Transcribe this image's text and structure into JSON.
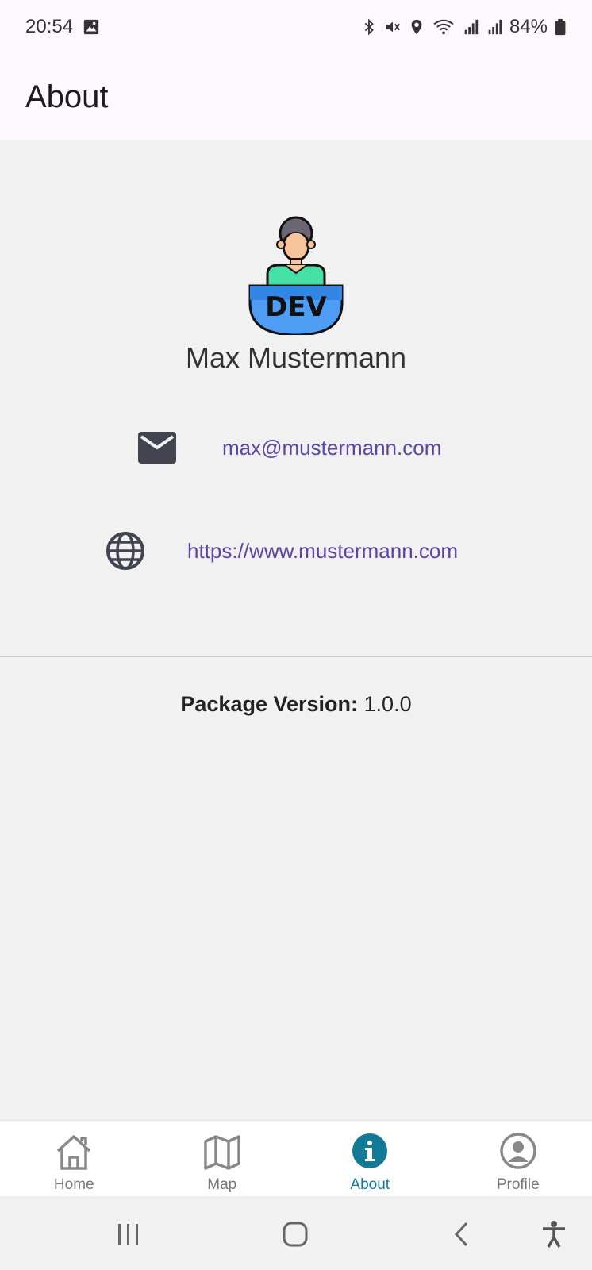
{
  "status_bar": {
    "time": "20:54",
    "battery_percent": "84%",
    "icons": [
      "image-icon",
      "bluetooth-icon",
      "mute-icon",
      "location-icon",
      "wifi-icon",
      "signal-icon",
      "signal-icon",
      "battery-icon"
    ]
  },
  "app_bar": {
    "title": "About"
  },
  "developer": {
    "avatar_badge": "DEV",
    "name": "Max Mustermann",
    "email": "max@mustermann.com",
    "website": "https://www.mustermann.com"
  },
  "version": {
    "label": "Package Version:",
    "value": "1.0.0"
  },
  "bottom_nav": {
    "items": [
      {
        "label": "Home",
        "icon": "home-icon",
        "active": false
      },
      {
        "label": "Map",
        "icon": "map-icon",
        "active": false
      },
      {
        "label": "About",
        "icon": "info-icon",
        "active": true
      },
      {
        "label": "Profile",
        "icon": "profile-icon",
        "active": false
      }
    ]
  },
  "colors": {
    "accent": "#127a96",
    "link": "#5b46a3",
    "background": "#f1f1f1",
    "app_bar": "#fdf8fc"
  }
}
